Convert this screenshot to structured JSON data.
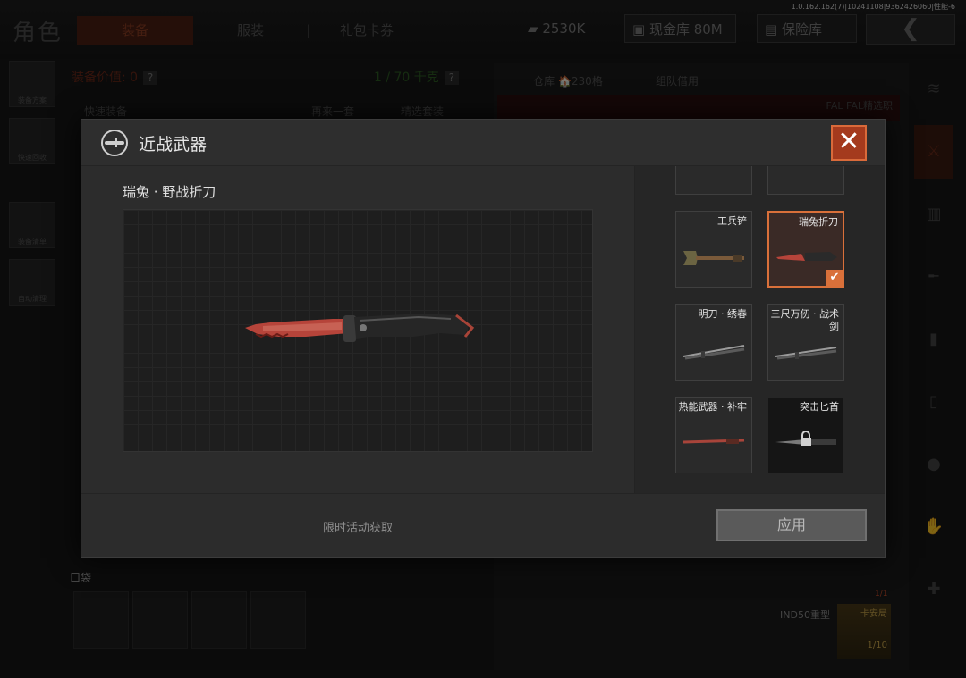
{
  "app": {
    "page_title": "角色",
    "version": "1.0.162.162(7)|10241108|9362426060|性能-6"
  },
  "top_tabs": [
    "装备",
    "服装",
    "|",
    "礼包卡券"
  ],
  "currency": {
    "cash": "2530K",
    "vault": "现金库 80M",
    "insurance": "保险库"
  },
  "left_rail": [
    "装备方案",
    "快速回收",
    "装备清单",
    "自动清理"
  ],
  "loadout": {
    "value_label": "装备价值: 0",
    "weight": "1 / 70 千克",
    "help": "?",
    "quick_equip": "快速装备",
    "reequip": "再来一套",
    "recommended": "精选套装"
  },
  "right_panel": {
    "tab_warehouse": "仓库 🏠230格",
    "tab_team": "组队借用",
    "banner_text": "FAL    FAL精选职"
  },
  "bottom": {
    "pocket_label": "口袋",
    "helmet_label": "IND50重型",
    "gold_card_label": "卡安局",
    "gold_count": "1/10",
    "ammo_count": "1/1"
  },
  "modal": {
    "title": "近战武器",
    "close_icon": "✕",
    "preview_name": "瑞兔 · 野战折刀",
    "footer_note": "限时活动获取",
    "apply_label": "应用",
    "items": [
      {
        "label": "工兵铲",
        "art": "shovel",
        "state": "normal"
      },
      {
        "label": "瑞兔折刀",
        "art": "red-knife",
        "state": "selected"
      },
      {
        "label": "明刀 · 绣春",
        "art": "sword-pair",
        "state": "normal"
      },
      {
        "label": "三尺万仞 · 战术剑",
        "art": "sword-pair",
        "state": "normal"
      },
      {
        "label": "热能武器 · 补牢",
        "art": "red-blade",
        "state": "normal"
      },
      {
        "label": "突击匕首",
        "art": "dagger",
        "state": "locked"
      }
    ]
  },
  "colors": {
    "accent_orange": "#d9703a",
    "close_red": "#a43a1d",
    "modal_bg": "#2c2c2c"
  }
}
